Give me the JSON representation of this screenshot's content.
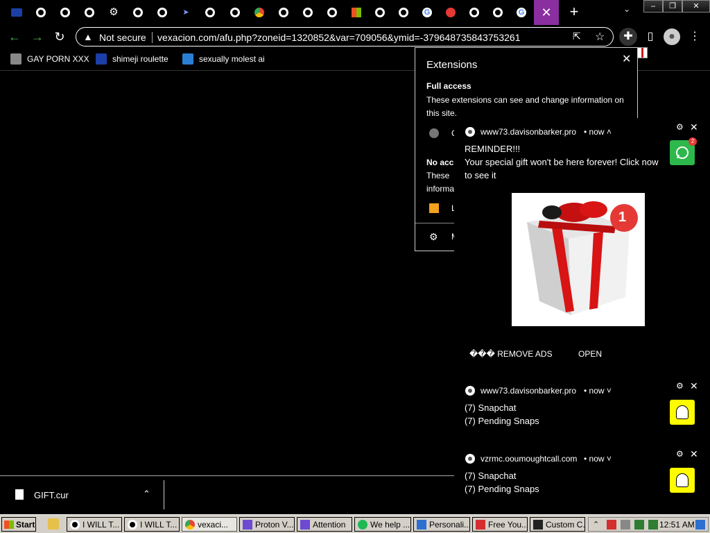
{
  "tabs": [
    "eu",
    "globe",
    "globe",
    "globe",
    "gear",
    "globe",
    "globe",
    "pointer",
    "globe",
    "globe",
    "chrome",
    "globe",
    "globe",
    "globe",
    "microsoft",
    "globe",
    "globe",
    "google",
    "red",
    "globe",
    "globe",
    "google"
  ],
  "active_tab_close": "✕",
  "new_tab_label": "+",
  "window_controls": [
    "–",
    "❐",
    "✕"
  ],
  "address_bar": {
    "security_label": "Not secure",
    "url": "vexacion.com/afu.php?zoneid=1320852&var=709056&ymid=-379648735843753261"
  },
  "bookmarks": [
    {
      "label": "GAY PORN XXX",
      "icon": "gray"
    },
    {
      "label": "shimeji roulette",
      "icon": "#1c3ea8"
    },
    {
      "label": "sexually molest ai",
      "icon": "#2a7fd4"
    }
  ],
  "extensions_panel": {
    "title": "Extensions",
    "full_access_heading": "Full access",
    "full_access_text": "These extensions can see and change information on this site.",
    "full_access_item": "C",
    "no_access_heading": "No acc",
    "no_access_text_1": "These",
    "no_access_text_2": "informa",
    "no_access_item": "L",
    "manage_label": "M"
  },
  "notifications": [
    {
      "site": "www73.davisonbarker.pro",
      "time": "• now ˄",
      "lines": [
        "REMINDER!!!",
        "Your special gift won't be here forever! Click now",
        "to see it"
      ],
      "badge_count": "2",
      "image_badge": "1",
      "buttons": [
        "��� REMOVE ADS",
        "OPEN"
      ]
    },
    {
      "site": "www73.davisonbarker.pro",
      "time": "• now ˅",
      "lines": [
        "(7) Snapchat",
        "(7) Pending Snaps"
      ]
    },
    {
      "site": "vzrmc.ooumoughtcall.com",
      "time": "• now ˅",
      "lines": [
        "(7) Snapchat",
        "(7) Pending Snaps"
      ]
    }
  ],
  "download": {
    "filename": "GIFT.cur"
  },
  "taskbar": {
    "start_label": "Start",
    "buttons": [
      "I WILL T...",
      "I WILL T...",
      "vexaci...",
      "Proton V...",
      "Attention",
      "We help ...",
      "Personali...",
      "Free You...",
      "Custom C..."
    ],
    "clock": "12:51 AM"
  },
  "colors": {
    "active_tab": "#8a2ea0",
    "nav_arrow": "#4caf50",
    "whatsapp": "#2db84c",
    "snapchat": "#fffc00",
    "gift_ribbon": "#d81414"
  }
}
